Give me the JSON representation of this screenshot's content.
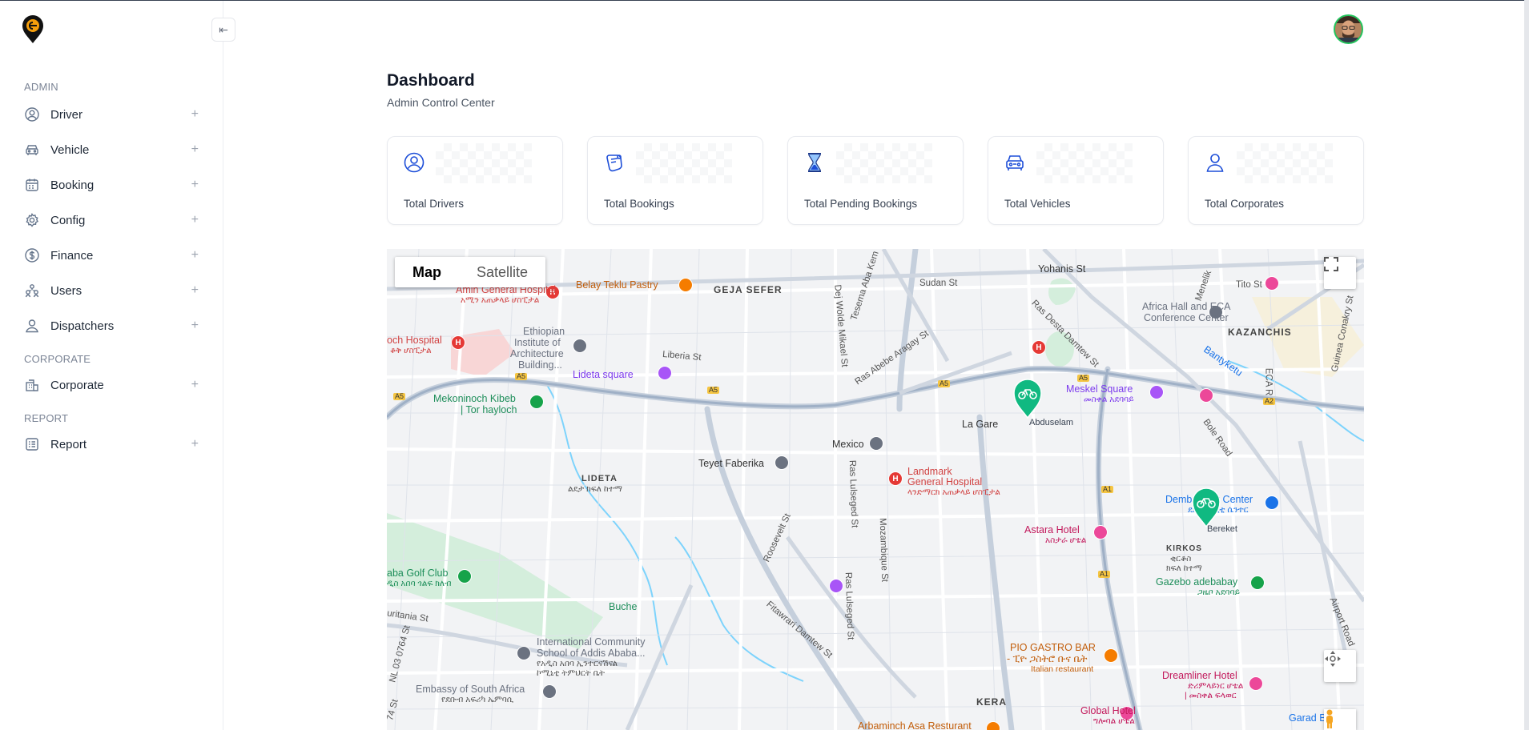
{
  "sidebar": {
    "sections": [
      {
        "label": "ADMIN"
      },
      {
        "label": "CORPORATE"
      },
      {
        "label": "REPORT"
      }
    ],
    "items": [
      {
        "label": "Driver",
        "icon": "user-circle-icon"
      },
      {
        "label": "Vehicle",
        "icon": "car-icon"
      },
      {
        "label": "Booking",
        "icon": "calendar-icon"
      },
      {
        "label": "Config",
        "icon": "gear-icon"
      },
      {
        "label": "Finance",
        "icon": "dollar-icon"
      },
      {
        "label": "Users",
        "icon": "users-icon"
      },
      {
        "label": "Dispatchers",
        "icon": "user-icon"
      },
      {
        "label": "Corporate",
        "icon": "building-icon"
      },
      {
        "label": "Report",
        "icon": "report-icon"
      }
    ],
    "expand_symbol": "+",
    "collapse_symbol": "⇤"
  },
  "header": {
    "title": "Dashboard",
    "subtitle": "Admin Control Center"
  },
  "cards": [
    {
      "label": "Total Drivers",
      "icon": "user-circle-icon"
    },
    {
      "label": "Total Bookings",
      "icon": "booking-icon"
    },
    {
      "label": "Total Pending Bookings",
      "icon": "hourglass-icon"
    },
    {
      "label": "Total Vehicles",
      "icon": "car-front-icon"
    },
    {
      "label": "Total Corporates",
      "icon": "person-icon"
    }
  ],
  "map": {
    "tabs": [
      "Map",
      "Satellite"
    ],
    "active_tab": "Map",
    "labels": {
      "amin_hospital": "Amin General Hospital",
      "amin_hospital_am": "አሚን አጠቃላይ ሆስፒታል",
      "belay": "Belay Teklu Pastry",
      "geja": "GEJA SEFER",
      "sudan": "Sudan St",
      "yohanis": "Yohanis St",
      "tito": "Tito St",
      "menelik": "Menelik",
      "africa_hall": "Africa Hall and ECA",
      "africa_hall2": "Conference Center",
      "kazanchis": "KAZANCHIS",
      "guinea": "Guinea Conakry St",
      "eca": "ECA R",
      "banty": "Bantyketu",
      "ras_desta": "Ras Desta Damtew St",
      "ras_abebe": "Ras Abebe Aragay St",
      "tesema": "Tesema Aba Kem",
      "dej_wolde": "Dej Wolde Mikael St",
      "loch_hospital": "och Hospital",
      "loch_hospital_am": "ቆቅ ሆስፒታል",
      "eth_inst": "Ethiopian",
      "eth_inst2": "Institute of",
      "eth_inst3": "Architecture",
      "eth_inst4": "Building...",
      "lideta_sq": "Lideta square",
      "liberia": "Liberia St",
      "mekoninoch": "Mekoninoch Kibeb",
      "tor": "| Tor hayloch",
      "meskel": "Meskel Square",
      "meskel_am": "መስቀል አደባባይ",
      "la_gare": "La Gare",
      "abduselam": "Abduselam",
      "bole": "Bole Road",
      "mexico": "Mexico",
      "teyet": "Teyet Faberika",
      "lideta": "LIDETA",
      "lideta_am": "ልደታ ክፍለ ከተማ",
      "landmark": "Landmark",
      "landmark2": "General Hospital",
      "landmark_am": "ላንድማርክ አጠቃላይ ሆስፒታል",
      "ras_lulseged": "Ras Lulseged St",
      "mozambique": "Mozambique St",
      "roosevelt": "Roosevelt St",
      "dembel": "Dembel City Center",
      "dembel_am": "ደምበል ሲቲ ሴንተር",
      "bereket": "Bereket",
      "astara": "Astara Hotel",
      "astara_am": "አስታራ ሆቴል",
      "kirkos": "KIRKOS",
      "kirkos_am": "ቂርቆስ",
      "kirkos_am2": "ክፍለ ከተማ",
      "gazebo": "Gazebo adebabay",
      "gazebo_am": "ጋዜቦ አደባባይ",
      "golf": "aba Golf Club",
      "golf_am": "ዲስ አበባ ጎልፍ ክለብ",
      "mauritania": "uritania St",
      "buche": "Buche",
      "fitawrari": "Fitawrari Damtew St",
      "intl_school": "International Community",
      "intl_school2": "School of Addis Ababa...",
      "intl_school_am": "የአዲስ አበባ ኢንተርናሽናል",
      "intl_school_am2": "ኮሚኒቲ ትምህርት ቤት",
      "nl": "NL 03 0764 St",
      "embassy": "Embassy of South Africa",
      "embassy_am": "የደቡብ አፍሪካ ኤምባሲ",
      "pio": "PIO GASTRO BAR",
      "pio_am": "- ፒዮ ጋስትሮ ቡና ቤት",
      "pio_type": "Italian restaurant",
      "dreamliner": "Dreamliner Hotel",
      "dreamliner_am": "ድሪምላይነር ሆቴል",
      "dreamliner_am2": "| መስቀል ፍላወር",
      "airport": "Airport Road",
      "kera": "KERA",
      "global": "Global Hotel",
      "global_am": "ግሎባል ሆቴል",
      "arbaminch": "Arbaminch Asa Resturant",
      "garad": "Garad B",
      "a5": "A5",
      "a1": "A1",
      "a2": "A2",
      "r74": "74 St",
      "hospital_symbol": "H"
    }
  },
  "colors": {
    "accent": "#1d4ed8",
    "marker_green": "#10b981",
    "map_bg": "#f3f4f6",
    "road": "#ffffff",
    "highway": "#aab8cc"
  }
}
